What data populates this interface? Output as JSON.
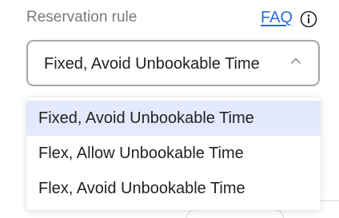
{
  "reservation": {
    "label": "Reservation rule",
    "faq_link": "FAQ",
    "info_icon": "info-circle-icon",
    "selected_value": "Fixed, Avoid Unbookable Time",
    "chevron_icon": "chevron-up-icon",
    "options": [
      {
        "label": "Fixed, Avoid Unbookable Time",
        "selected": true
      },
      {
        "label": "Flex, Allow Unbookable Time",
        "selected": false
      },
      {
        "label": "Flex, Avoid Unbookable Time",
        "selected": false
      }
    ]
  },
  "colors": {
    "label_text": "#7b7b7b",
    "link": "#2c6ad6",
    "selected_option_bg": "#e4e9fd",
    "select_border": "#a6a6a6",
    "text": "#222222"
  }
}
